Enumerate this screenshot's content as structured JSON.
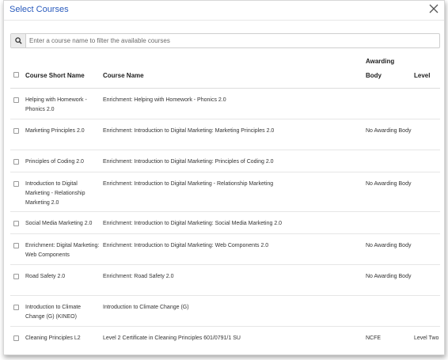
{
  "dialog": {
    "title": "Select Courses"
  },
  "search": {
    "placeholder": "Enter a course name to filter the available courses"
  },
  "table": {
    "headers": {
      "short_name": "Course Short Name",
      "course_name": "Course Name",
      "awarding_body_line1": "Awarding",
      "awarding_body_line2": "Body",
      "level": "Level"
    },
    "rows": [
      {
        "short": "Helping with Homework - Phonics 2.0",
        "name": "Enrichment: Helping with Homework - Phonics 2.0",
        "awarding": "",
        "level": ""
      },
      {
        "short": "Marketing Principles 2.0",
        "name": "Enrichment: Introduction to Digital Marketing: Marketing Principles 2.0",
        "awarding": "No Awarding Body",
        "level": ""
      },
      {
        "short": "Principles of Coding 2.0",
        "name": "Enrichment: Introduction to Digital Marketing: Principles of Coding 2.0",
        "awarding": "",
        "level": ""
      },
      {
        "short": "Introduction to Digital Marketing - Relationship Marketing 2.0",
        "name": "Enrichment: Introduction to Digital Marketing - Relationship Marketing",
        "awarding": "No Awarding Body",
        "level": ""
      },
      {
        "short": "Social Media Marketing 2.0",
        "name": "Enrichment: Introduction to Digital Marketing: Social Media Marketing 2.0",
        "awarding": "",
        "level": ""
      },
      {
        "short": "Enrichment: Digital Marketing: Web Components",
        "name": "Enrichment: Introduction to Digital Marketing: Web Components 2.0",
        "awarding": "No Awarding Body",
        "level": ""
      },
      {
        "short": "Road Safety 2.0",
        "name": "Enrichment: Road Safety 2.0",
        "awarding": "No Awarding Body",
        "level": ""
      },
      {
        "short": "Introduction to Climate Change (G) (KINEO)",
        "name": "Introduction to Climate Change (G)",
        "awarding": "",
        "level": ""
      },
      {
        "short": "Cleaning Principles L2",
        "name": "Level 2 Certificate in Cleaning Principles 601/0791/1 SU",
        "awarding": "NCFE",
        "level": "Level Two"
      }
    ]
  },
  "icons": {
    "close": "close-icon",
    "search": "search-icon"
  },
  "colors": {
    "title": "#2a5bbd",
    "border": "#d7d7d7"
  }
}
